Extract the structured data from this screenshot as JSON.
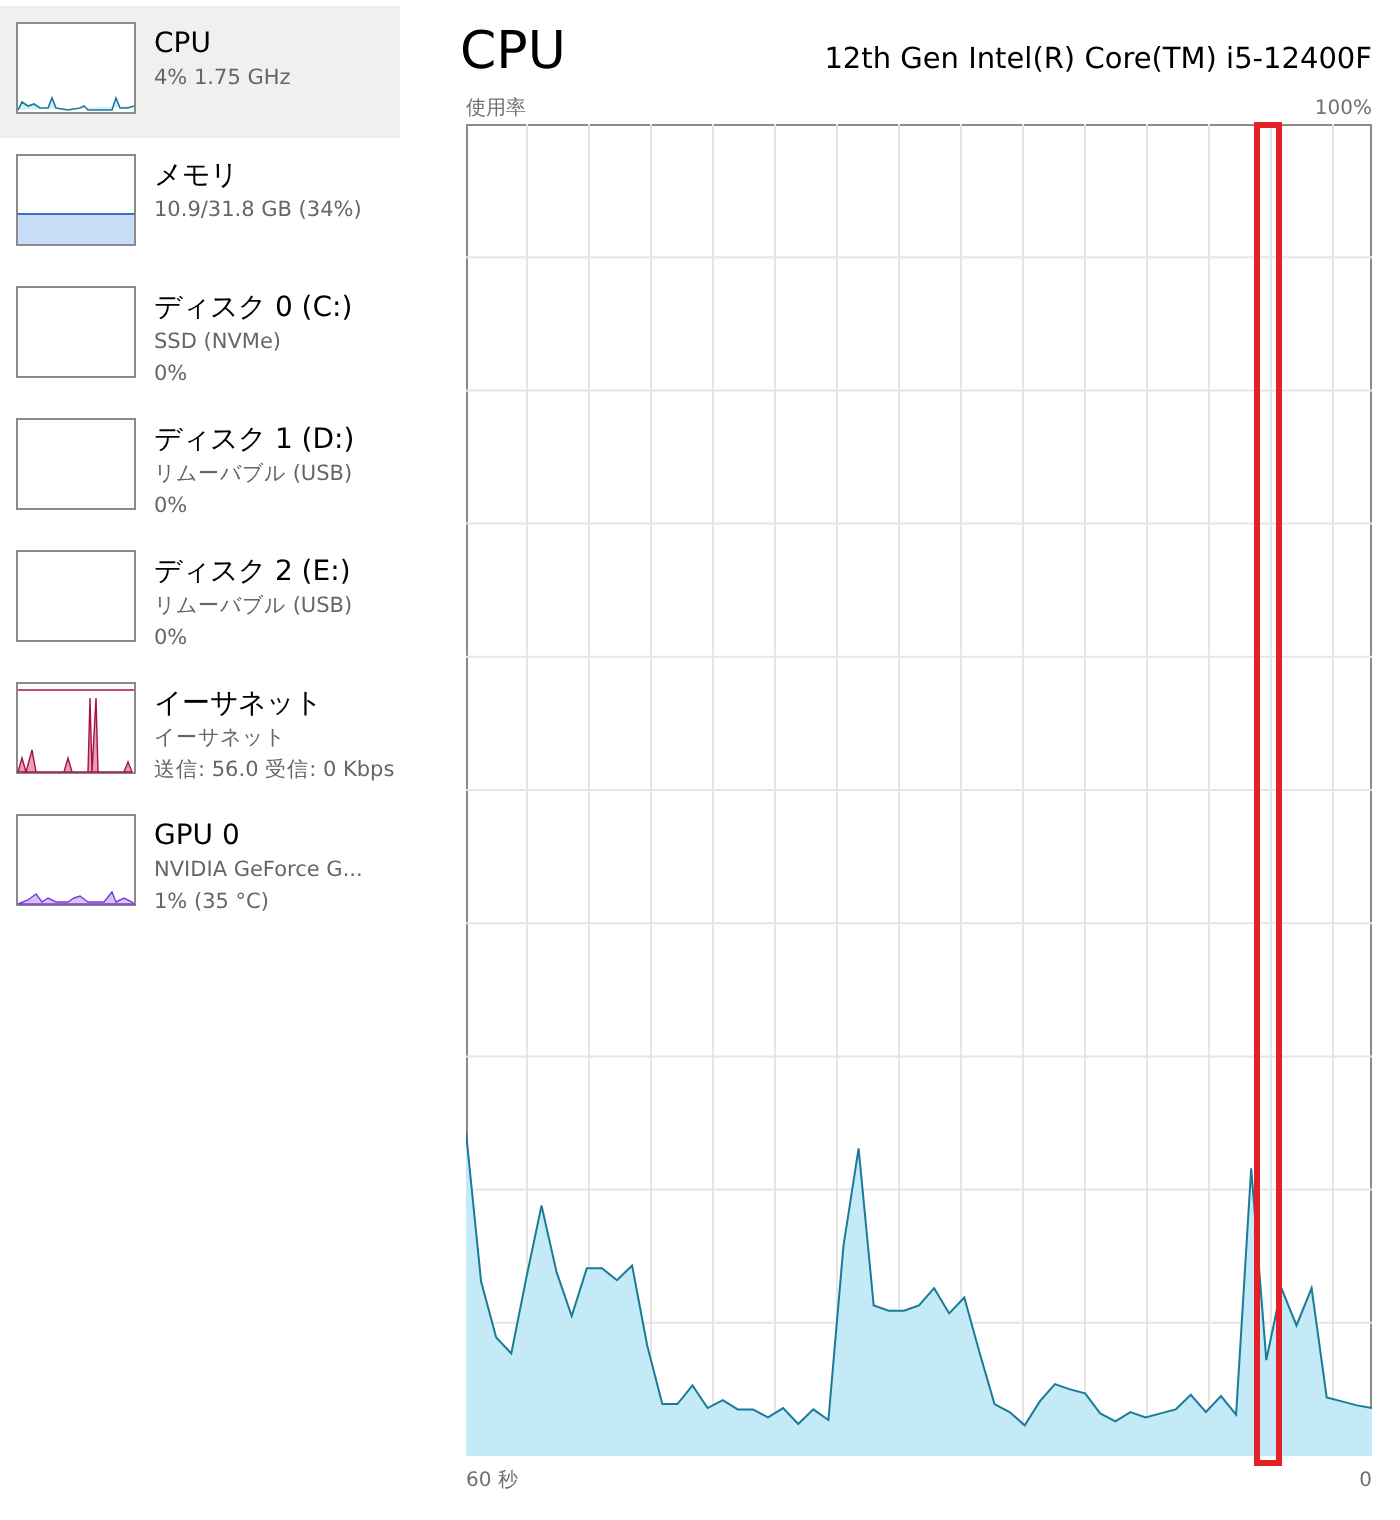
{
  "sidebar": {
    "items": [
      {
        "kind": "cpu",
        "title": "CPU",
        "lines": [
          "4%  1.75 GHz"
        ],
        "selected": true
      },
      {
        "kind": "memory",
        "title": "メモリ",
        "lines": [
          "10.9/31.8 GB (34%)"
        ],
        "selected": false
      },
      {
        "kind": "disk",
        "title": "ディスク 0 (C:)",
        "lines": [
          "SSD (NVMe)",
          "0%"
        ],
        "selected": false
      },
      {
        "kind": "disk",
        "title": "ディスク 1 (D:)",
        "lines": [
          "リムーバブル (USB)",
          "0%"
        ],
        "selected": false
      },
      {
        "kind": "disk",
        "title": "ディスク 2 (E:)",
        "lines": [
          "リムーバブル (USB)",
          "0%"
        ],
        "selected": false
      },
      {
        "kind": "ethernet",
        "title": "イーサネット",
        "lines": [
          "イーサネット",
          "送信: 56.0 受信: 0 Kbps"
        ],
        "selected": false
      },
      {
        "kind": "gpu",
        "title": "GPU 0",
        "lines": [
          "NVIDIA GeForce G...",
          "1%  (35 °C)"
        ],
        "selected": false
      }
    ]
  },
  "main": {
    "title": "CPU",
    "model": "12th Gen Intel(R) Core(TM) i5-12400F",
    "graph": {
      "usage_label": "使用率",
      "max_label": "100%",
      "time_start": "60 秒",
      "time_end": "0"
    }
  }
}
